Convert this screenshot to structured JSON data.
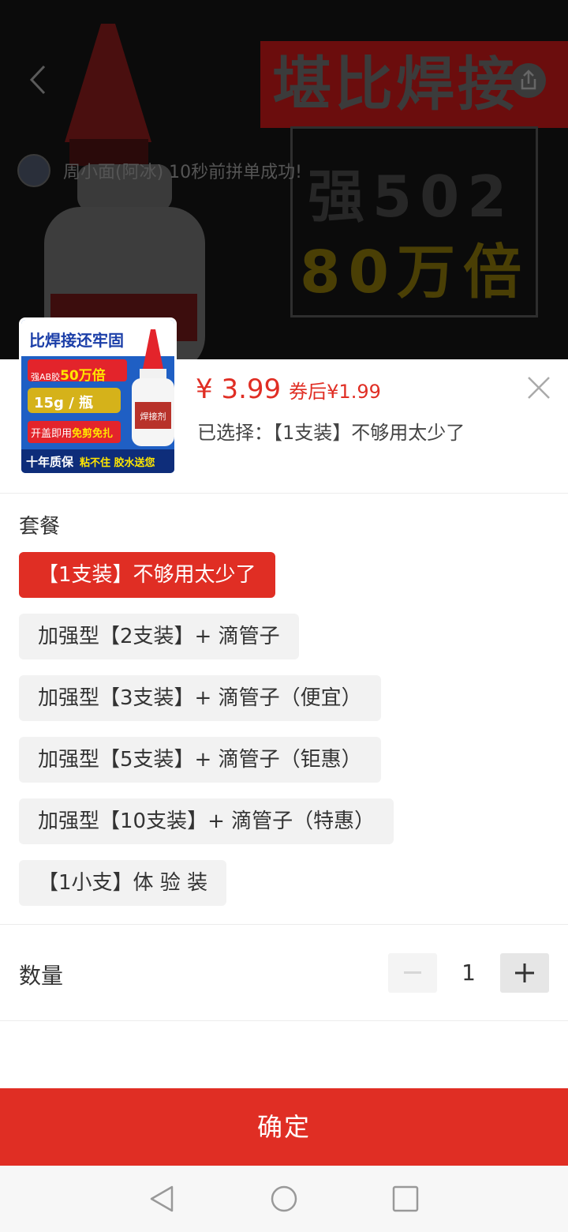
{
  "background": {
    "headline": "堪比焊接",
    "line1": "强502",
    "line2": "80万倍",
    "notice": "周小面(阿冰) 10秒前拼单成功!"
  },
  "thumbnail": {
    "title": "比焊接还牢固",
    "tag1_prefix": "强AB胶",
    "tag1_value": "50万倍",
    "tag2": "15g / 瓶",
    "tag3_prefix": "开盖即用",
    "tag3_value": "免剪免扎",
    "footer_main": "十年质保",
    "footer_extra": "粘不住 胶水送您",
    "bottle_label": "焊接剂"
  },
  "product": {
    "price": "¥ 3.99",
    "coupon_price": "券后¥1.99",
    "selected_label": "已选择：",
    "selected_value": "【1支装】不够用太少了"
  },
  "options": {
    "group_title": "套餐",
    "items": [
      {
        "label": "【1支装】不够用太少了",
        "selected": true
      },
      {
        "label": "加强型【2支装】+ 滴管子",
        "selected": false
      },
      {
        "label": "加强型【3支装】+ 滴管子（便宜）",
        "selected": false
      },
      {
        "label": "加强型【5支装】+ 滴管子（钜惠）",
        "selected": false
      },
      {
        "label": "加强型【10支装】+ 滴管子（特惠）",
        "selected": false
      },
      {
        "label": "【1小支】体 验 装",
        "selected": false
      }
    ]
  },
  "quantity": {
    "label": "数量",
    "value": "1"
  },
  "confirm_label": "确定",
  "colors": {
    "accent": "#e02e24",
    "option_bg": "#f2f2f2"
  }
}
